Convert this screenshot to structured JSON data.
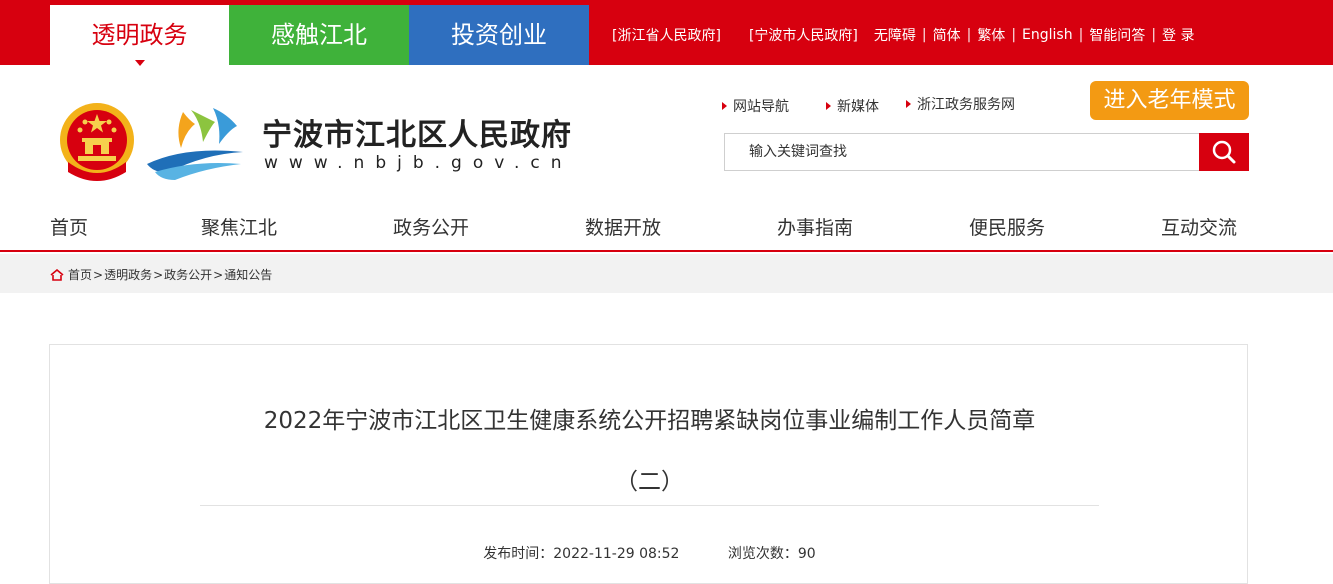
{
  "top_tabs": [
    "透明政务",
    "感触江北",
    "投资创业"
  ],
  "top_links": [
    "[浙江省人民政府]",
    "[宁波市人民政府]",
    "无障碍",
    "简体",
    "繁体",
    "English",
    "智能问答",
    "登 录"
  ],
  "header": {
    "site_name": "宁波市江北区人民政府",
    "site_url": "www.nbjb.gov.cn",
    "quick_links": [
      "网站导航",
      "新媒体",
      "浙江政务服务网"
    ],
    "elder_mode": "进入老年模式",
    "search_placeholder": "输入关键词查找"
  },
  "nav": [
    "首页",
    "聚焦江北",
    "政务公开",
    "数据开放",
    "办事指南",
    "便民服务",
    "互动交流"
  ],
  "breadcrumb": [
    "首页",
    "透明政务",
    "政务公开",
    "通知公告"
  ],
  "article": {
    "title_line1": "2022年宁波市江北区卫生健康系统公开招聘紧缺岗位事业编制工作人员简章",
    "title_line2": "（二）",
    "publish_label": "发布时间：",
    "publish_time": "2022-11-29 08:52",
    "views_label": "浏览次数：",
    "views": "90"
  },
  "colors": {
    "primary_red": "#d7000f",
    "green": "#3fb23a",
    "blue": "#2f6fbf",
    "orange": "#f39a13"
  }
}
